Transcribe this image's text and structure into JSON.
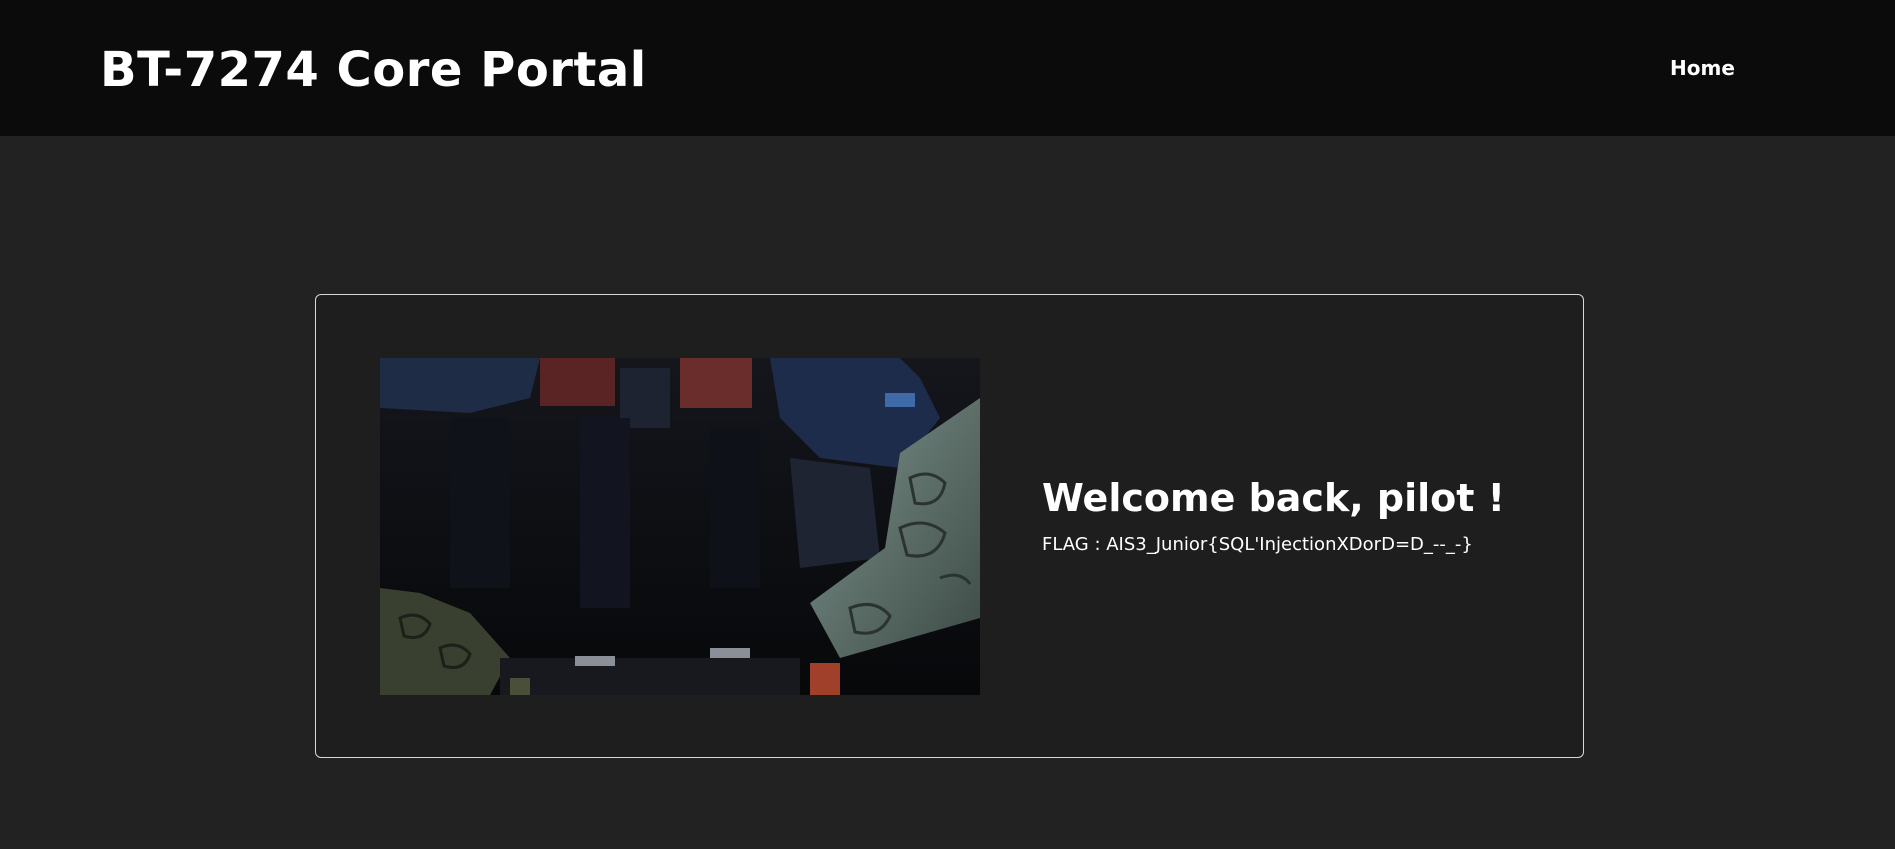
{
  "header": {
    "title": "BT-7274 Core Portal",
    "nav": {
      "home_label": "Home"
    }
  },
  "main": {
    "heading": "Welcome back, pilot !",
    "flag_text": "FLAG : AIS3_Junior{SQL'InjectionXDorD=D_--_-}",
    "image_icon": "mecha-cockpit-image"
  },
  "colors": {
    "header_bg": "#0b0b0b",
    "page_bg": "#222222",
    "card_bg": "#1e1e1e",
    "card_border": "#d8d8d8",
    "text": "#ffffff"
  }
}
